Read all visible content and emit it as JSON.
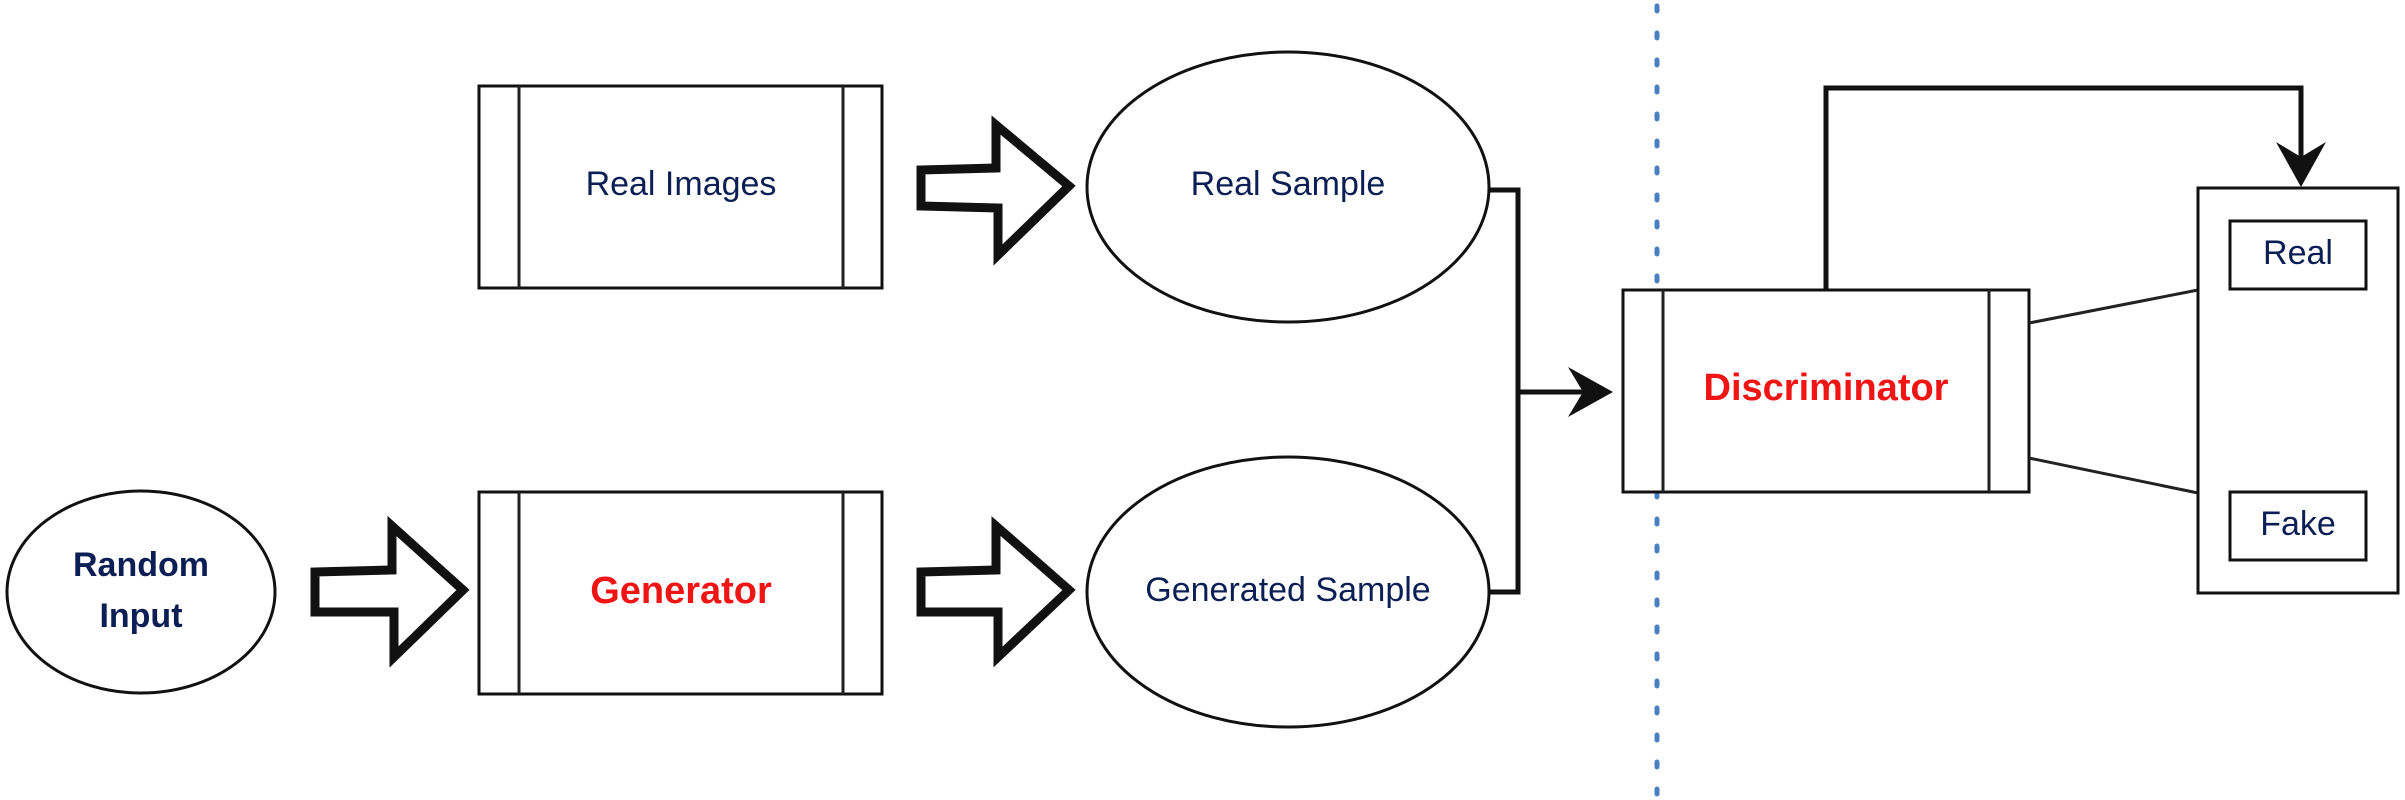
{
  "nodes": {
    "random_input": {
      "line1": "Random",
      "line2": "Input"
    },
    "real_images": "Real Images",
    "generator": "Generator",
    "real_sample": "Real Sample",
    "generated_sample": "Generated Sample",
    "discriminator": "Discriminator",
    "output_real": "Real",
    "output_fake": "Fake"
  },
  "colors": {
    "text": "#0b1f55",
    "model_text": "#f01414",
    "divider": "#4a7fc1",
    "stroke": "#111111"
  }
}
